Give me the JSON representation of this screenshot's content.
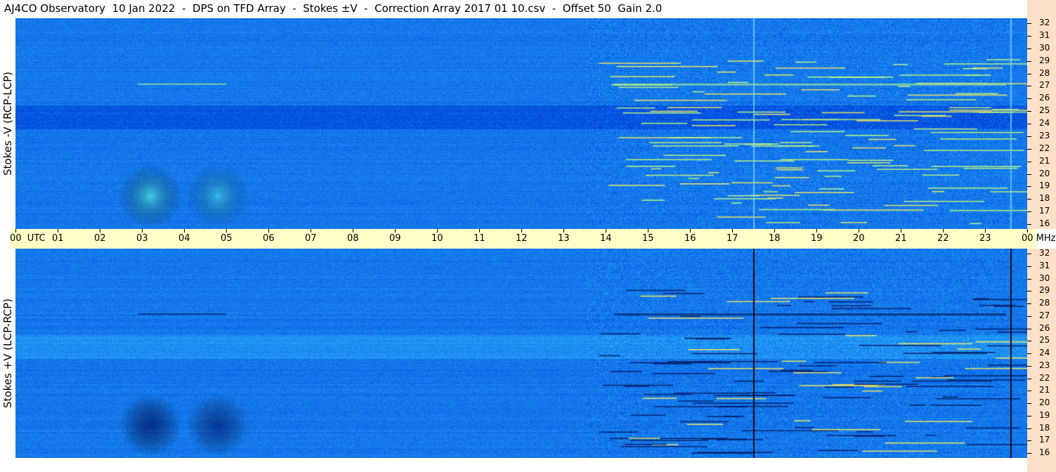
{
  "title": "AJ4CO Observatory  10 Jan 2022  -  DPS on TFD Array  -  Stokes ±V  -  Correction Array 2017 01 10.csv  -  Offset 50  Gain 2.0",
  "colors": {
    "background": "#1a6fe6",
    "time_axis_bg": "#ffffc8",
    "freq_axis_bg": "#fde0c8"
  },
  "chart_data": {
    "type": "heatmap",
    "x": {
      "unit": "UTC",
      "range": [
        0,
        24
      ],
      "tick_labels": [
        "00  UTC",
        "01",
        "02",
        "03",
        "04",
        "05",
        "06",
        "07",
        "08",
        "09",
        "10",
        "11",
        "12",
        "13",
        "14",
        "15",
        "16",
        "17",
        "18",
        "19",
        "20",
        "21",
        "22",
        "23",
        "00 MHz"
      ]
    },
    "y": {
      "unit": "MHz",
      "range": [
        16,
        32
      ],
      "tick_labels": [
        "32",
        "31",
        "30",
        "29",
        "28",
        "27",
        "26",
        "25",
        "24",
        "23",
        "22",
        "21",
        "20",
        "19",
        "18",
        "17",
        "16"
      ]
    },
    "panels": [
      {
        "ylabel": "Stokes -V (RCP-LCP)",
        "position": "top"
      },
      {
        "ylabel": "Stokes +V (LCP-RCP)",
        "position": "bottom"
      }
    ],
    "dark_time_markers_utc": [
      17.5,
      23.6
    ],
    "grid": false
  }
}
